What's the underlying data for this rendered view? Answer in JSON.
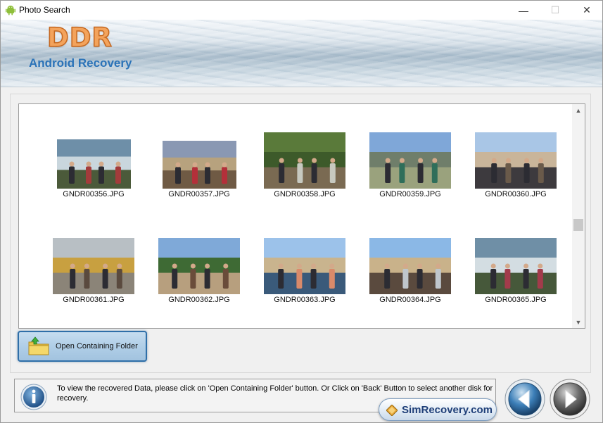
{
  "window": {
    "title": "Photo Search",
    "controls": {
      "minimize": "—",
      "maximize": "☐",
      "close": "✕"
    }
  },
  "banner": {
    "logo": "DDR",
    "product": "Android Recovery"
  },
  "gallery": {
    "items": [
      {
        "filename": "GNDR00356.JPG",
        "palette": [
          "#6e8fa8",
          "#c9d6dd",
          "#4b5a3a",
          "#a33b3b"
        ]
      },
      {
        "filename": "GNDR00357.JPG",
        "palette": [
          "#8a98b3",
          "#b7a27e",
          "#6f5a44",
          "#b3303a"
        ]
      },
      {
        "filename": "GNDR00358.JPG",
        "palette": [
          "#5a7a3a",
          "#3d5a2a",
          "#7a6a52",
          "#c7c9c0"
        ]
      },
      {
        "filename": "GNDR00359.JPG",
        "palette": [
          "#7fa7d8",
          "#6f7e6a",
          "#9aa27d",
          "#2f6e5a"
        ]
      },
      {
        "filename": "GNDR00360.JPG",
        "palette": [
          "#a9c6e6",
          "#c9b59a",
          "#3d3a3e",
          "#6a5a4a"
        ]
      },
      {
        "filename": "GNDR00361.JPG",
        "palette": [
          "#b8bfc4",
          "#c8a040",
          "#8b8478",
          "#5a4a3e"
        ]
      },
      {
        "filename": "GNDR00362.JPG",
        "palette": [
          "#7fa9d8",
          "#3e6a34",
          "#b79f7e",
          "#6a4c3a"
        ]
      },
      {
        "filename": "GNDR00363.JPG",
        "palette": [
          "#9cc2ea",
          "#c9b48e",
          "#3a5a7a",
          "#d98a6a"
        ]
      },
      {
        "filename": "GNDR00364.JPG",
        "palette": [
          "#8bb8e6",
          "#c9b28a",
          "#5a4a3e",
          "#bfc6cc"
        ]
      },
      {
        "filename": "GNDR00365.JPG",
        "palette": [
          "#6f8fa6",
          "#d3dde2",
          "#46583a",
          "#a33b4b"
        ]
      }
    ]
  },
  "open_button": {
    "label": "Open Containing Folder"
  },
  "info": {
    "text": "To view the recovered Data, please click on 'Open Containing Folder' button. Or Click on 'Back' Button to select another disk for recovery."
  },
  "badge": {
    "text": "SimRecovery.com"
  },
  "colors": {
    "accent": "#2f6fa8",
    "logo": "#f3a35c",
    "product": "#2b73b8"
  }
}
